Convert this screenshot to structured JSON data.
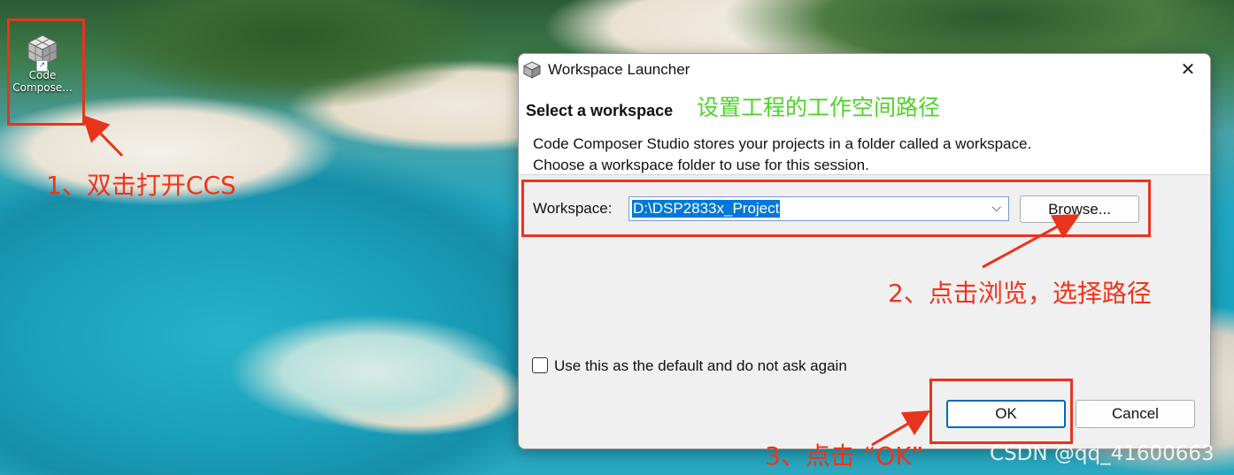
{
  "desktop": {
    "icon": {
      "name": "cube-app-icon",
      "label_line1": "Code",
      "label_line2": "Compose..."
    }
  },
  "dialog": {
    "title": "Workspace Launcher",
    "close_glyph": "✕",
    "header_title": "Select a workspace",
    "description_line1": "Code Composer Studio stores your projects in a folder called a workspace.",
    "description_line2": "Choose a workspace folder to use for this session.",
    "workspace_label": "Workspace:",
    "workspace_value": "D:\\DSP2833x_Project",
    "dropdown_glyph": "⌵",
    "browse_label": "Browse...",
    "checkbox_label": "Use this as the default and do not ask again",
    "checkbox_checked": false,
    "ok_label": "OK",
    "cancel_label": "Cancel"
  },
  "annotations": {
    "step1": "1、双击打开CCS",
    "header_note": "设置工程的工作空间路径",
    "step2": "2、点击浏览，选择路径",
    "step3": "3、点击 “OK”"
  },
  "watermark": "CSDN @qq_41600663",
  "colors": {
    "annotation_red": "#e8341c",
    "annotation_green": "#4fd22a",
    "selection_blue": "#0078d7"
  }
}
